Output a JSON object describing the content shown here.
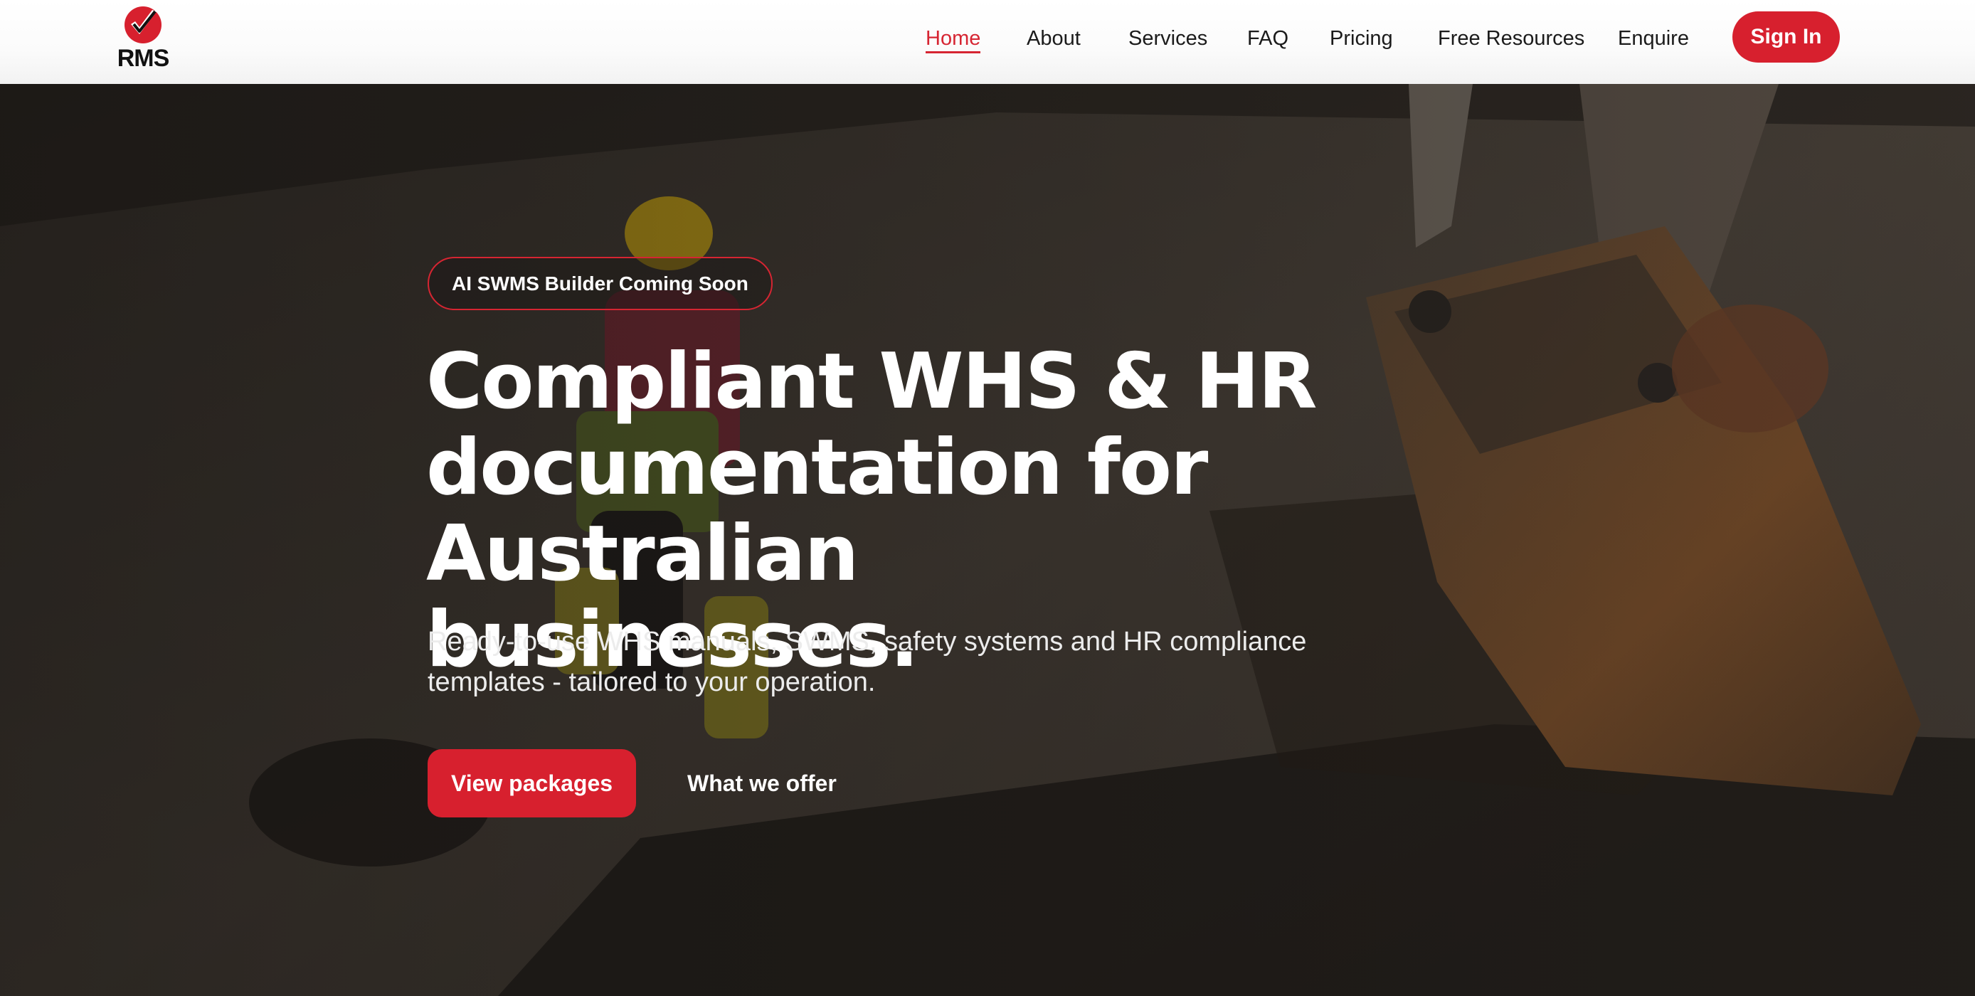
{
  "brand": {
    "name": "RMS",
    "accent_color": "#d7202e",
    "logo_icon": "check-badge-icon"
  },
  "nav": {
    "items": [
      {
        "label": "Home",
        "active": true
      },
      {
        "label": "About",
        "active": false
      },
      {
        "label": "Services",
        "active": false
      },
      {
        "label": "FAQ",
        "active": false
      },
      {
        "label": "Pricing",
        "active": false
      },
      {
        "label": "Free Resources",
        "active": false
      },
      {
        "label": "Enquire",
        "active": false
      }
    ],
    "signin_label": "Sign In"
  },
  "hero": {
    "badge": "AI SWMS Builder Coming Soon",
    "headline": {
      "line1": "Compliant WHS & HR",
      "line2": "documentation for Australian",
      "line3": "businesses."
    },
    "subtext": {
      "line1": "Ready-to-use WHS manuals, SWMS, safety systems and HR compliance",
      "line2": "templates - tailored to your operation."
    },
    "primary_cta": "View packages",
    "secondary_cta": "What we offer"
  }
}
